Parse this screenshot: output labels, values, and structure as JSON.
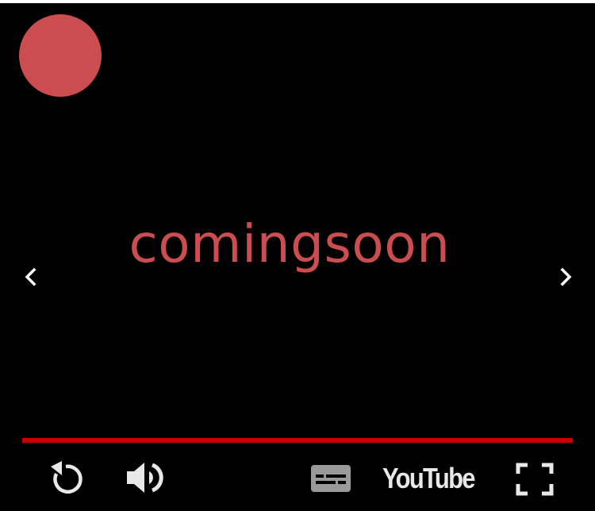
{
  "player": {
    "title": "comingsoon",
    "logo_text": "YouTube",
    "progress": 1.0,
    "colors": {
      "background": "#000000",
      "accent": "#cc4d50",
      "progress": "#cc0000",
      "controls": "#e8e8e8"
    },
    "icons": {
      "avatar": "channel-avatar",
      "prev": "chevron-left-icon",
      "next": "chevron-right-icon",
      "replay": "replay-icon",
      "volume": "volume-icon",
      "captions": "captions-icon",
      "fullscreen": "fullscreen-icon"
    }
  }
}
